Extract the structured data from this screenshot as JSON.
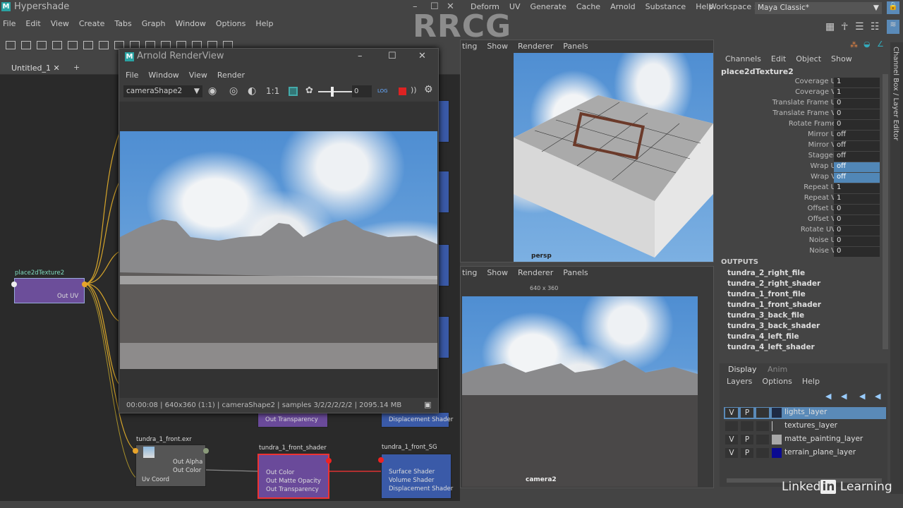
{
  "hypershade": {
    "title": "Hypershade",
    "menu": [
      "File",
      "Edit",
      "View",
      "Create",
      "Tabs",
      "Graph",
      "Window",
      "Options",
      "Help"
    ],
    "tab": "Untitled_1",
    "tab_add": "+",
    "nodes": {
      "place2d": {
        "name": "place2dTexture2",
        "port": "Out UV"
      },
      "file": {
        "name": "tundra_1_front.exr",
        "ports": [
          "Out Alpha",
          "Out Color",
          "Uv Coord"
        ]
      },
      "shader": {
        "name": "tundra_1_front_shader",
        "ports": [
          "Out Color",
          "Out Matte Opacity",
          "Out Transparency"
        ]
      },
      "sg": {
        "name": "tundra_1_front_SG",
        "ports": [
          "Surface Shader",
          "Volume Shader",
          "Displacement Shader"
        ]
      },
      "partial_shader_port": "Out Transparency",
      "partial_sg_port": "Displacement Shader"
    }
  },
  "renderview": {
    "title": "Arnold RenderView",
    "menu": [
      "File",
      "Window",
      "View",
      "Render"
    ],
    "camera": "cameraShape2",
    "ratio": "1:1",
    "exposure": "0",
    "log": "LOG",
    "status": "00:00:08 | 640x360 (1:1) | cameraShape2  | samples 3/2/2/2/2/2 | 2095.14 MB"
  },
  "main": {
    "menu": [
      "Deform",
      "UV",
      "Generate",
      "Cache",
      "Arnold",
      "Substance",
      "Help"
    ],
    "workspace_label": "Workspace :",
    "workspace": "Maya Classic*"
  },
  "viewports": {
    "menu": [
      "ting",
      "Show",
      "Renderer",
      "Panels"
    ],
    "persp": "persp",
    "camera": "camera2",
    "resolution": "640 x 360"
  },
  "channelbox": {
    "menu": [
      "Channels",
      "Edit",
      "Object",
      "Show"
    ],
    "node": "place2dTexture2",
    "side_tab": "Channel Box / Layer Editor",
    "attrs": [
      {
        "n": "Coverage U",
        "v": "1"
      },
      {
        "n": "Coverage V",
        "v": "1"
      },
      {
        "n": "Translate Frame U",
        "v": "0"
      },
      {
        "n": "Translate Frame V",
        "v": "0"
      },
      {
        "n": "Rotate Frame",
        "v": "0"
      },
      {
        "n": "Mirror U",
        "v": "off"
      },
      {
        "n": "Mirror V",
        "v": "off"
      },
      {
        "n": "Stagger",
        "v": "off"
      },
      {
        "n": "Wrap U",
        "v": "off",
        "sel": true
      },
      {
        "n": "Wrap V",
        "v": "off",
        "sel": true
      },
      {
        "n": "Repeat U",
        "v": "1"
      },
      {
        "n": "Repeat V",
        "v": "1"
      },
      {
        "n": "Offset U",
        "v": "0"
      },
      {
        "n": "Offset V",
        "v": "0"
      },
      {
        "n": "Rotate UV",
        "v": "0"
      },
      {
        "n": "Noise U",
        "v": "0"
      },
      {
        "n": "Noise V",
        "v": "0"
      }
    ],
    "outputs_label": "OUTPUTS",
    "outputs": [
      "tundra_2_right_file",
      "tundra_2_right_shader",
      "tundra_1_front_file",
      "tundra_1_front_shader",
      "tundra_3_back_file",
      "tundra_3_back_shader",
      "tundra_4_left_file",
      "tundra_4_left_shader"
    ]
  },
  "layers": {
    "tabs": [
      "Display",
      "Anim"
    ],
    "menu": [
      "Layers",
      "Options",
      "Help"
    ],
    "items": [
      {
        "v": "V",
        "p": "P",
        "name": "lights_layer",
        "color": "#1e2a44",
        "sel": true
      },
      {
        "v": "",
        "p": "",
        "name": "textures_layer",
        "color": "transparent"
      },
      {
        "v": "V",
        "p": "P",
        "name": "matte_painting_layer",
        "color": "#a8a8a8"
      },
      {
        "v": "V",
        "p": "P",
        "name": "terrain_plane_layer",
        "color": "#0a0a90"
      }
    ]
  },
  "watermark": "RRCG",
  "branding": {
    "pre": "Linked",
    "in": "in",
    "post": " Learning"
  }
}
